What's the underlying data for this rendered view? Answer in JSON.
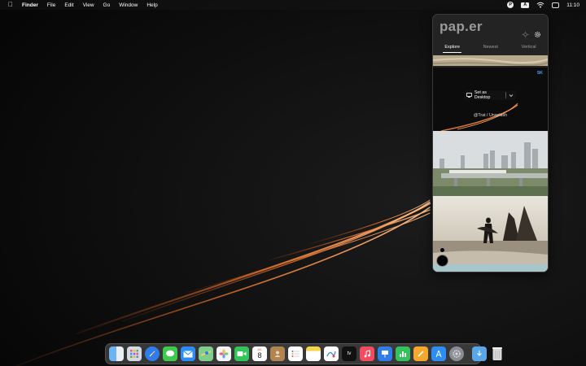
{
  "menubar": {
    "app_name": "Finder",
    "menus": [
      "File",
      "Edit",
      "View",
      "Go",
      "Window",
      "Help"
    ],
    "clock": "11:10",
    "status_icons": [
      "paper-icon",
      "input-source-icon",
      "wifi-icon",
      "control-center-icon"
    ],
    "input_source_label": "A",
    "paper_icon_label": "P"
  },
  "popover": {
    "logo": "pap.er",
    "tabs": [
      "Explore",
      "Newest",
      "Vertical"
    ],
    "active_tab": "Explore",
    "featured": {
      "resolution": "5K",
      "set_button": "Set as Desktop",
      "credit": "@Trat / Unsplash"
    }
  },
  "dock": {
    "apps": [
      "Finder",
      "Launchpad",
      "Safari",
      "Messages",
      "Mail",
      "Maps",
      "Photos",
      "FaceTime",
      "Calendar",
      "Contacts",
      "Reminders",
      "Notes",
      "Freeform",
      "TV",
      "Music",
      "Keynote",
      "Numbers",
      "Pages",
      "App Store",
      "System Settings",
      "Downloads",
      "Trash"
    ],
    "calendar_day": "8",
    "calendar_month": "JUL",
    "tv_label": "tv"
  },
  "colors": {
    "accent_badge": "#4da3ff"
  }
}
